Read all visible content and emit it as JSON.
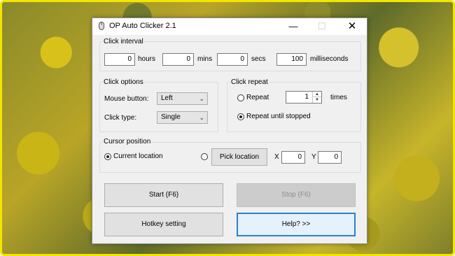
{
  "window": {
    "title": "OP Auto Clicker 2.1",
    "minimize_glyph": "—",
    "maximize_glyph": "☐",
    "close_glyph": "✕"
  },
  "click_interval": {
    "label": "Click interval",
    "hours": {
      "value": "0",
      "unit": "hours"
    },
    "mins": {
      "value": "0",
      "unit": "mins"
    },
    "secs": {
      "value": "0",
      "unit": "secs"
    },
    "milliseconds": {
      "value": "100",
      "unit": "milliseconds"
    }
  },
  "click_options": {
    "label": "Click options",
    "mouse_button_label": "Mouse button:",
    "mouse_button_value": "Left",
    "click_type_label": "Click type:",
    "click_type_value": "Single"
  },
  "click_repeat": {
    "label": "Click repeat",
    "repeat_label": "Repeat",
    "repeat_count": "1",
    "times_label": "times",
    "repeat_until_stopped_label": "Repeat until stopped",
    "selected": "repeat_until_stopped"
  },
  "cursor_position": {
    "label": "Cursor position",
    "current_location_label": "Current location",
    "pick_location_label": "Pick location",
    "x_label": "X",
    "x_value": "0",
    "y_label": "Y",
    "y_value": "0",
    "selected": "current_location"
  },
  "buttons": {
    "start": "Start (F6)",
    "stop": "Stop (F6)",
    "hotkey": "Hotkey setting",
    "help": "Help? >>"
  },
  "colors": {
    "frame_border": "#f2e600",
    "focus_border": "#2a7fd6",
    "window_bg": "#f0f0f0"
  }
}
